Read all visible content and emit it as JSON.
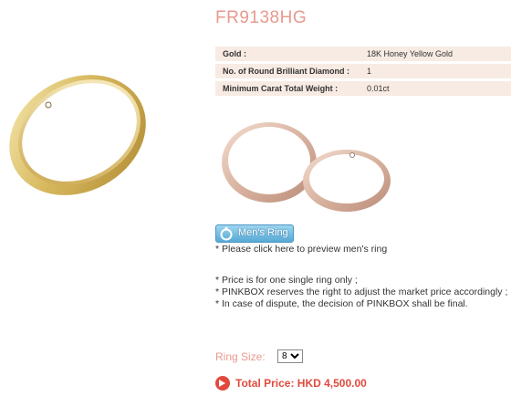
{
  "product": {
    "code": "FR9138HG",
    "specs": [
      {
        "label": "Gold :",
        "value": "18K Honey Yellow Gold"
      },
      {
        "label": "No. of Round Brilliant Diamond :",
        "value": "1"
      },
      {
        "label": "Minimum Carat Total Weight :",
        "value": "0.01ct"
      }
    ]
  },
  "mens_ring": {
    "button_label": "Men's Ring",
    "hint": "* Please click here to preview men's ring"
  },
  "notes": [
    "* Price is for one single ring only ;",
    "* PINKBOX reserves the right to adjust the market price accordingly ;",
    "* In case of dispute, the decision of PINKBOX shall be final."
  ],
  "ring_size": {
    "label": "Ring Size:",
    "selected": "8"
  },
  "total": {
    "label": "Total Price: HKD 4,500.00"
  },
  "colors": {
    "accent_pink": "#e8998f",
    "price_red": "#e04a3d",
    "table_bg": "#f7ebe3",
    "button_blue": "#56a9d6"
  }
}
